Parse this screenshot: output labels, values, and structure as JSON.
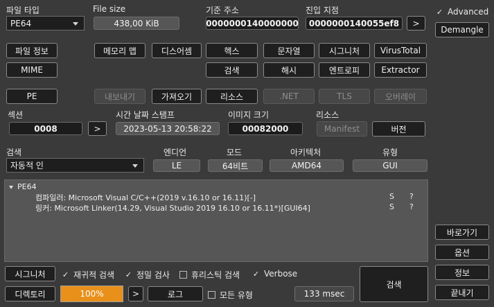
{
  "top": {
    "file_type_label": "파일 타입",
    "file_type_value": "PE64",
    "file_size_label": "File size",
    "file_size_value": "438,00 KiB",
    "base_address_label": "기준 주소",
    "base_address_value": "0000000140000000",
    "entry_point_label": "진입 지점",
    "entry_point_value": "0000000140055ef8",
    "entry_point_go": ">"
  },
  "right": {
    "advanced_label": "Advanced",
    "advanced_checked": "✓",
    "demangle": "Demangle",
    "goto": "바로가기",
    "options": "옵션",
    "info": "정보",
    "exit": "끝내기"
  },
  "tools": {
    "file_info": "파일 정보",
    "mime": "MIME",
    "memory_map": "메모리 맵",
    "disasm": "디스어셈",
    "hex": "헥스",
    "strings": "문자열",
    "signatures": "시그니처",
    "virustotal": "VirusTotal",
    "search": "검색",
    "hash": "해시",
    "entropy": "엔트로피",
    "extractor": "Extractor"
  },
  "pe_tabs": {
    "pe": "PE",
    "export": "내보내기",
    "import": "가져오기",
    "resources": "리소스",
    "net": ".NET",
    "tls": "TLS",
    "overlay": "오버레이"
  },
  "info": {
    "section_label": "섹션",
    "section_value": "0008",
    "section_go": ">",
    "timestamp_label": "시간 날짜 스탬프",
    "timestamp_value": "2023-05-13 20:58:22",
    "image_size_label": "이미지 크기",
    "image_size_value": "00082000",
    "resources_label": "리소스",
    "manifest": "Manifest",
    "version": "버전"
  },
  "scan": {
    "scan_label": "검색",
    "scan_value": "자동적 인",
    "endian_label": "엔디언",
    "endian_value": "LE",
    "mode_label": "모드",
    "mode_value": "64비트",
    "arch_label": "아키텍처",
    "arch_value": "AMD64",
    "type_label": "유형",
    "type_value": "GUI"
  },
  "results": {
    "root": "PE64",
    "items": [
      {
        "text": "컴파일러: Microsoft Visual C/C++(2019 v.16.10 or 16.11)[-]",
        "flag": "S",
        "q": "?"
      },
      {
        "text": "링커: Microsoft Linker(14.29, Visual Studio 2019 16.10 or 16.11*)[GUI64]",
        "flag": "S",
        "q": "?"
      }
    ]
  },
  "bottom": {
    "signatures": "시그니처",
    "recursive_label": "재귀적 검색",
    "recursive_mark": "✓",
    "deep_label": "정밀 검사",
    "deep_mark": "✓",
    "heuristic_label": "휴리스틱 검색",
    "verbose_label": "Verbose",
    "verbose_mark": "✓",
    "directory": "디렉토리",
    "progress_text": "100%",
    "progress_fraction": 1.0,
    "progress_color": "#e8901a",
    "next": ">",
    "log": "로그",
    "all_types_label": "모든 유형",
    "time": "133 msec",
    "scan_button": "검색"
  }
}
